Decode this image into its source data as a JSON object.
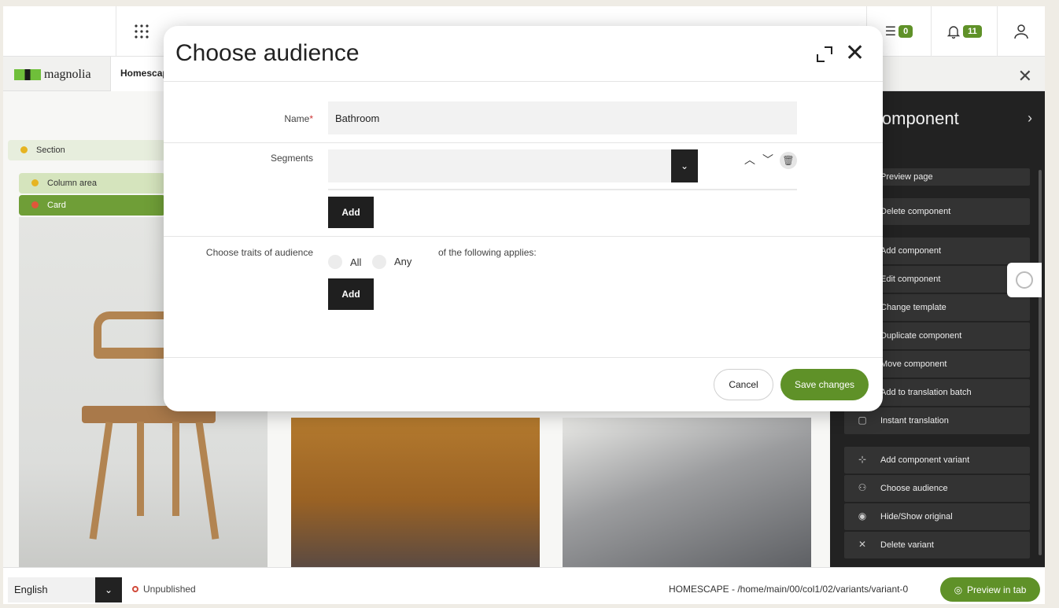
{
  "topbar": {
    "apps_icon": "grid-icon",
    "tasks_count": "0",
    "notifications_count": "11",
    "user_icon": "user-icon"
  },
  "tabbar": {
    "logo_text": "magnolia",
    "active_tab": "Homescape"
  },
  "canvas": {
    "section_label": "Section",
    "column_label": "Column area",
    "card_label": "Card",
    "colors": {
      "section_dot": "#e6b422",
      "column_dot": "#e6b422",
      "card_dot": "#e0573a"
    }
  },
  "right_panel": {
    "title": "Component",
    "items": [
      {
        "label": "Preview page",
        "icon": "preview-icon"
      },
      {
        "label": "Delete component",
        "icon": "trash-icon"
      },
      {
        "label": "Add component",
        "icon": "add-icon"
      },
      {
        "label": "Edit component",
        "icon": "edit-icon"
      },
      {
        "label": "Change template",
        "icon": "template-icon"
      },
      {
        "label": "Duplicate component",
        "icon": "duplicate-icon"
      },
      {
        "label": "Move component",
        "icon": "move-icon"
      },
      {
        "label": "Add to translation batch",
        "icon": "translate-icon"
      },
      {
        "label": "Instant translation",
        "icon": "instant-translate-icon"
      },
      {
        "label": "Add component variant",
        "icon": "variant-icon"
      },
      {
        "label": "Choose audience",
        "icon": "audience-icon"
      },
      {
        "label": "Hide/Show original",
        "icon": "eye-icon"
      },
      {
        "label": "Delete variant",
        "icon": "close-icon"
      }
    ]
  },
  "bottombar": {
    "language": "English",
    "status": "Unpublished",
    "path": "HOMESCAPE - /home/main/00/col1/02/variants/variant-0",
    "preview_button": "Preview in tab"
  },
  "dialog": {
    "title": "Choose audience",
    "name_label": "Name",
    "name_required": "*",
    "name_value": "Bathroom",
    "segments_label": "Segments",
    "segments_add": "Add",
    "traits_label": "Choose traits of audience",
    "radio_all": "All",
    "radio_any": "Any",
    "applies_text": "of the following applies:",
    "traits_add": "Add",
    "cancel": "Cancel",
    "save": "Save changes"
  },
  "colors": {
    "brand_green": "#5f9128",
    "dark": "#1f1f1f"
  }
}
